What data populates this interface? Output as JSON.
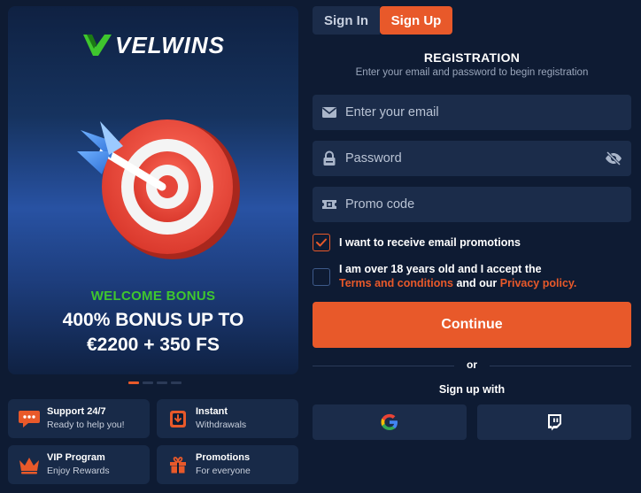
{
  "brand": {
    "name": "VELWINS"
  },
  "banner": {
    "welcome": "WELCOME BONUS",
    "bonus_line1": "400% BONUS UP TO",
    "bonus_line2": "€2200 + 350 FS",
    "slides_total": 4,
    "slide_active": 1
  },
  "features": [
    {
      "title": "Support 24/7",
      "subtitle": "Ready to help you!",
      "icon": "chat-bubble-icon"
    },
    {
      "title": "Instant",
      "subtitle": "Withdrawals",
      "icon": "withdraw-box-icon"
    },
    {
      "title": "VIP Program",
      "subtitle": "Enjoy Rewards",
      "icon": "crown-icon"
    },
    {
      "title": "Promotions",
      "subtitle": "For everyone",
      "icon": "gift-icon"
    }
  ],
  "tabs": {
    "signin": "Sign In",
    "signup": "Sign Up",
    "active": "signup"
  },
  "form": {
    "title": "REGISTRATION",
    "subtitle": "Enter your email and password to begin registration",
    "email_placeholder": "Enter your email",
    "password_placeholder": "Password",
    "promo_placeholder": "Promo code",
    "email_promo_label": "I want to receive email promotions",
    "email_promo_checked": true,
    "age_label_1": "I am over 18 years old and I accept the",
    "terms_link": "Terms and conditions",
    "age_label_and": "and our",
    "privacy_link": "Privacy policy.",
    "age_checked": false,
    "continue": "Continue",
    "or": "or",
    "signup_with": "Sign up with"
  },
  "colors": {
    "background": "#0e1b33",
    "panel": "#1b2c4a",
    "accent": "#e8592a",
    "green": "#3fc62e"
  }
}
